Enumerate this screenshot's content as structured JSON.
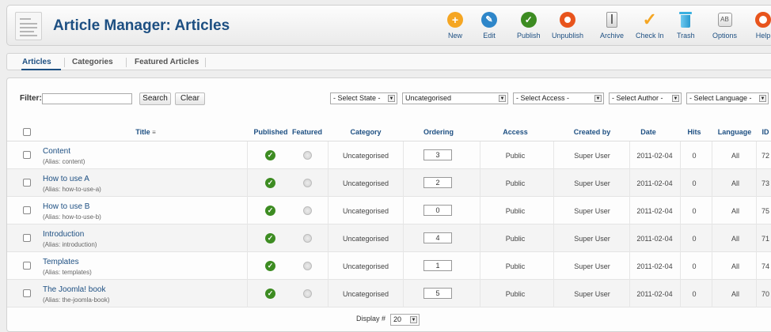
{
  "header": {
    "title": "Article Manager: Articles",
    "toolbar": [
      {
        "label": "New",
        "icon": "plus-icon",
        "color": "#f5a623"
      },
      {
        "label": "Edit",
        "icon": "pencil-icon",
        "color": "#2e86c9"
      },
      {
        "label": "Publish",
        "icon": "checkmark-icon",
        "color": "#3d8c22"
      },
      {
        "label": "Unpublish",
        "icon": "unpublish-icon",
        "color": "#e8541c"
      },
      {
        "label": "Archive",
        "icon": "archive-icon",
        "color": "#888888"
      },
      {
        "label": "Check In",
        "icon": "checkin-icon",
        "color": "#f5a623"
      },
      {
        "label": "Trash",
        "icon": "trash-icon",
        "color": "#3ab0e0"
      },
      {
        "label": "Options",
        "icon": "options-icon",
        "color": "#777777"
      },
      {
        "label": "Help",
        "icon": "lifebuoy-icon",
        "color": "#e8541c"
      }
    ]
  },
  "tabs": [
    {
      "label": "Articles",
      "active": true
    },
    {
      "label": "Categories",
      "active": false
    },
    {
      "label": "Featured Articles",
      "active": false
    }
  ],
  "filter": {
    "label": "Filter:",
    "value": "",
    "search_label": "Search",
    "clear_label": "Clear",
    "selects": [
      "- Select State -",
      "Uncategorised",
      "- Select Access -",
      "- Select Author -",
      "- Select Language -"
    ]
  },
  "table": {
    "columns": [
      "Title",
      "Published",
      "Featured",
      "Category",
      "Ordering",
      "Access",
      "Created by",
      "Date",
      "Hits",
      "Language",
      "ID"
    ],
    "rows": [
      {
        "title": "Content",
        "alias": "(Alias: content)",
        "category": "Uncategorised",
        "ordering": "3",
        "access": "Public",
        "created_by": "Super User",
        "date": "2011-02-04",
        "hits": "0",
        "language": "All",
        "id": "72"
      },
      {
        "title": "How to use A",
        "alias": "(Alias: how-to-use-a)",
        "category": "Uncategorised",
        "ordering": "2",
        "access": "Public",
        "created_by": "Super User",
        "date": "2011-02-04",
        "hits": "0",
        "language": "All",
        "id": "73"
      },
      {
        "title": "How to use B",
        "alias": "(Alias: how-to-use-b)",
        "category": "Uncategorised",
        "ordering": "0",
        "access": "Public",
        "created_by": "Super User",
        "date": "2011-02-04",
        "hits": "0",
        "language": "All",
        "id": "75"
      },
      {
        "title": "Introduction",
        "alias": "(Alias: introduction)",
        "category": "Uncategorised",
        "ordering": "4",
        "access": "Public",
        "created_by": "Super User",
        "date": "2011-02-04",
        "hits": "0",
        "language": "All",
        "id": "71"
      },
      {
        "title": "Templates",
        "alias": "(Alias: templates)",
        "category": "Uncategorised",
        "ordering": "1",
        "access": "Public",
        "created_by": "Super User",
        "date": "2011-02-04",
        "hits": "0",
        "language": "All",
        "id": "74"
      },
      {
        "title": "The Joomla! book",
        "alias": "(Alias: the-joomla-book)",
        "category": "Uncategorised",
        "ordering": "5",
        "access": "Public",
        "created_by": "Super User",
        "date": "2011-02-04",
        "hits": "0",
        "language": "All",
        "id": "70"
      }
    ]
  },
  "footer": {
    "display_label": "Display #",
    "display_value": "20"
  }
}
